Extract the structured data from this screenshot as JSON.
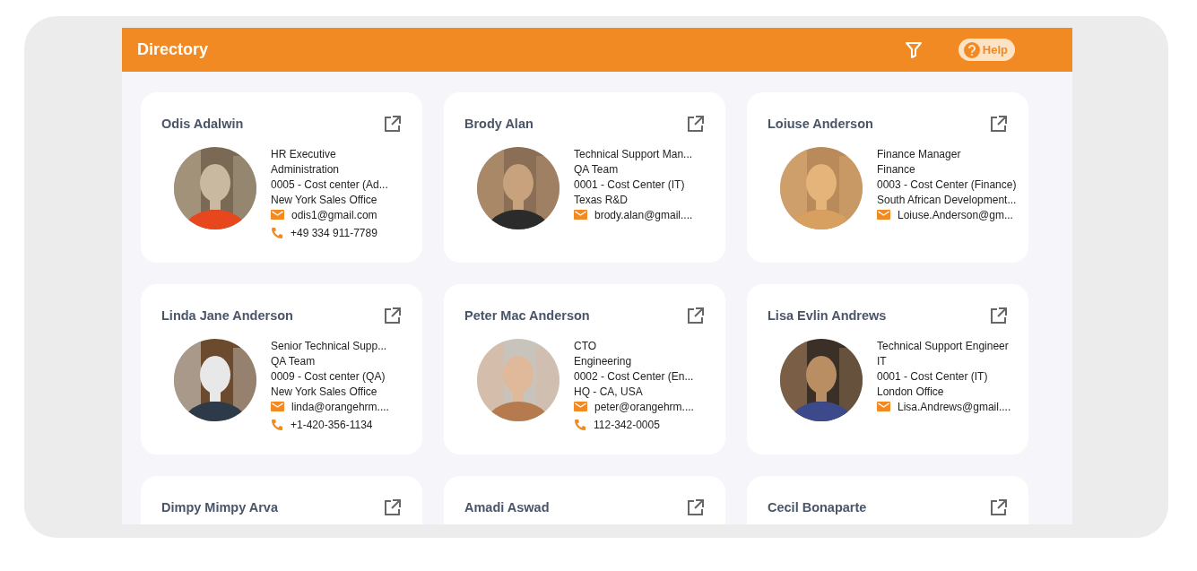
{
  "header": {
    "title": "Directory",
    "help": "Help"
  },
  "people": [
    {
      "name": "Odis Adalwin",
      "details": [
        "HR Executive",
        "Administration",
        "0005 - Cost center (Ad...",
        "New York Sales Office"
      ],
      "email": "odis1@gmail.com",
      "phone": "+49 334 911-7789"
    },
    {
      "name": "Brody Alan",
      "details": [
        "Technical Support Man...",
        "QA Team",
        "0001 - Cost Center (IT)",
        "Texas R&D"
      ],
      "email": "brody.alan@gmail...."
    },
    {
      "name": "Loiuse Anderson",
      "details": [
        "Finance Manager",
        "Finance",
        "0003 - Cost Center (Finance)",
        "South African Development..."
      ],
      "email": "Loiuse.Anderson@gm..."
    },
    {
      "name": "Linda Jane Anderson",
      "details": [
        "Senior Technical Supp...",
        "QA Team",
        "0009 - Cost center (QA)",
        "New York Sales Office"
      ],
      "email": "linda@orangehrm....",
      "phone": "+1-420-356-1134"
    },
    {
      "name": "Peter Mac Anderson",
      "details": [
        "CTO",
        "Engineering",
        "0002 - Cost Center (En...",
        "HQ - CA, USA"
      ],
      "email": "peter@orangehrm....",
      "phone": "112-342-0005"
    },
    {
      "name": "Lisa Evlin Andrews",
      "details": [
        "Technical Support Engineer",
        "IT",
        "0001 - Cost Center (IT)",
        "London Office"
      ],
      "email": "Lisa.Andrews@gmail...."
    },
    {
      "name": "Dimpy Mimpy Arva"
    },
    {
      "name": "Amadi Aswad"
    },
    {
      "name": "Cecil Bonaparte"
    }
  ]
}
